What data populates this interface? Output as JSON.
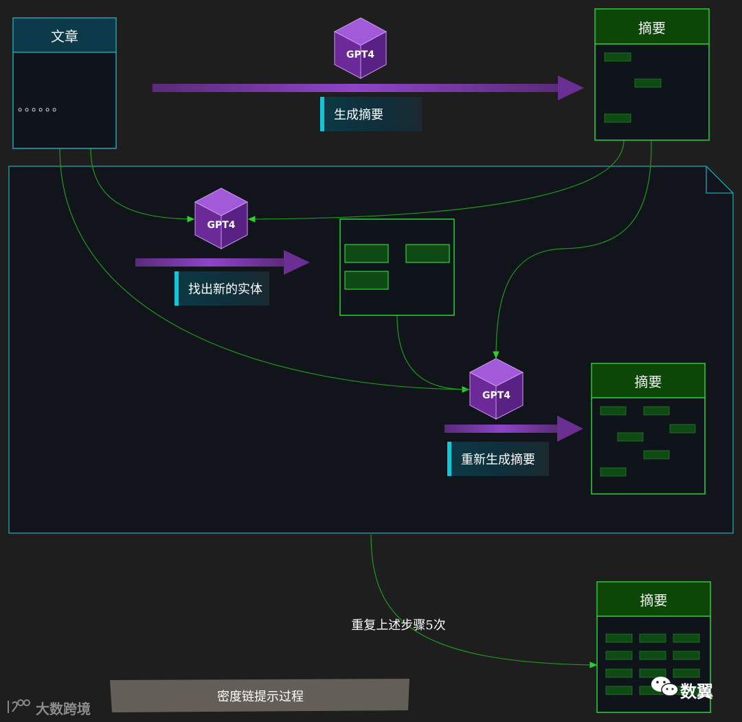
{
  "article": {
    "title": "文章",
    "dots": "。。。。。。"
  },
  "summary_top": {
    "title": "摘要"
  },
  "model": {
    "label": "GPT4"
  },
  "steps": {
    "generate": "生成摘要",
    "find_entities": "找出新的实体",
    "regenerate": "重新生成摘要"
  },
  "summary_mid": {
    "title": "摘要"
  },
  "summary_final": {
    "title": "摘要"
  },
  "repeat_note": "重复上述步骤5次",
  "caption": "密度链提示过程",
  "watermark_left": "大数跨境",
  "watermark_right": "数翼",
  "colors": {
    "background": "#1e1e1f",
    "panel": "#0f141b",
    "teal": "#1fa7b6",
    "green": "#2fd13a",
    "dark_green": "#0d4708",
    "purple": "#8e44c8",
    "accent_cyan": "#12c6d8"
  }
}
